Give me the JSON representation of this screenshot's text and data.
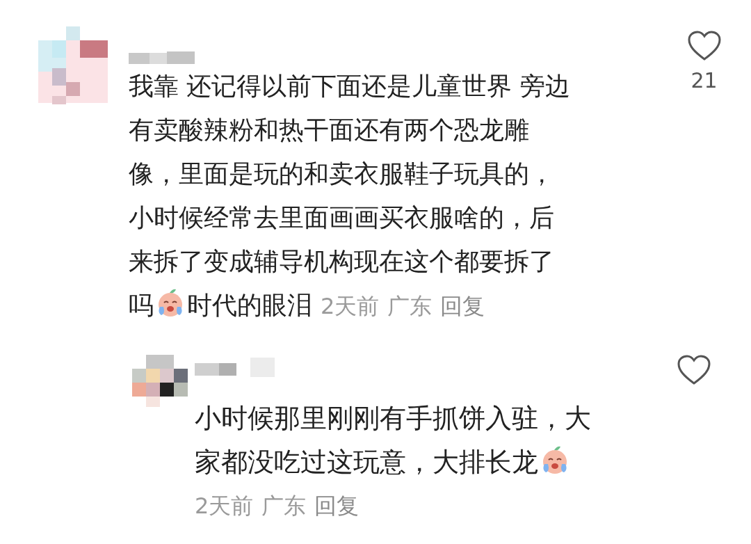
{
  "comments": [
    {
      "lines": [
        {
          "segments": [
            {
              "kind": "text",
              "text": "我靠 还记得以前下面还是儿童世界 旁边"
            }
          ]
        },
        {
          "segments": [
            {
              "kind": "text",
              "text": "有卖酸辣粉和热干面还有两个恐龙雕"
            }
          ]
        },
        {
          "segments": [
            {
              "kind": "text",
              "text": "像，里面是玩的和卖衣服鞋子玩具的，"
            }
          ]
        },
        {
          "segments": [
            {
              "kind": "text",
              "text": "小时候经常去里面画画买衣服啥的，后"
            }
          ]
        },
        {
          "segments": [
            {
              "kind": "text",
              "text": "来拆了变成辅导机构现在这个都要拆了"
            }
          ]
        },
        {
          "segments": [
            {
              "kind": "text",
              "text": "吗"
            },
            {
              "kind": "emoji"
            },
            {
              "kind": "text",
              "text": "时代的眼泪"
            }
          ]
        }
      ],
      "time": "2天前",
      "location": "广东",
      "reply_label": "回复",
      "liked": false,
      "likes": "21",
      "replies": [
        {
          "lines": [
            {
              "segments": [
                {
                  "kind": "text",
                  "text": "小时候那里刚刚有手抓饼入驻，大"
                }
              ]
            },
            {
              "segments": [
                {
                  "kind": "text",
                  "text": "家都没吃过这玩意，大排长龙"
                },
                {
                  "kind": "emoji"
                }
              ]
            }
          ],
          "time": "2天前",
          "location": "广东",
          "reply_label": "回复",
          "liked": false
        }
      ]
    }
  ]
}
